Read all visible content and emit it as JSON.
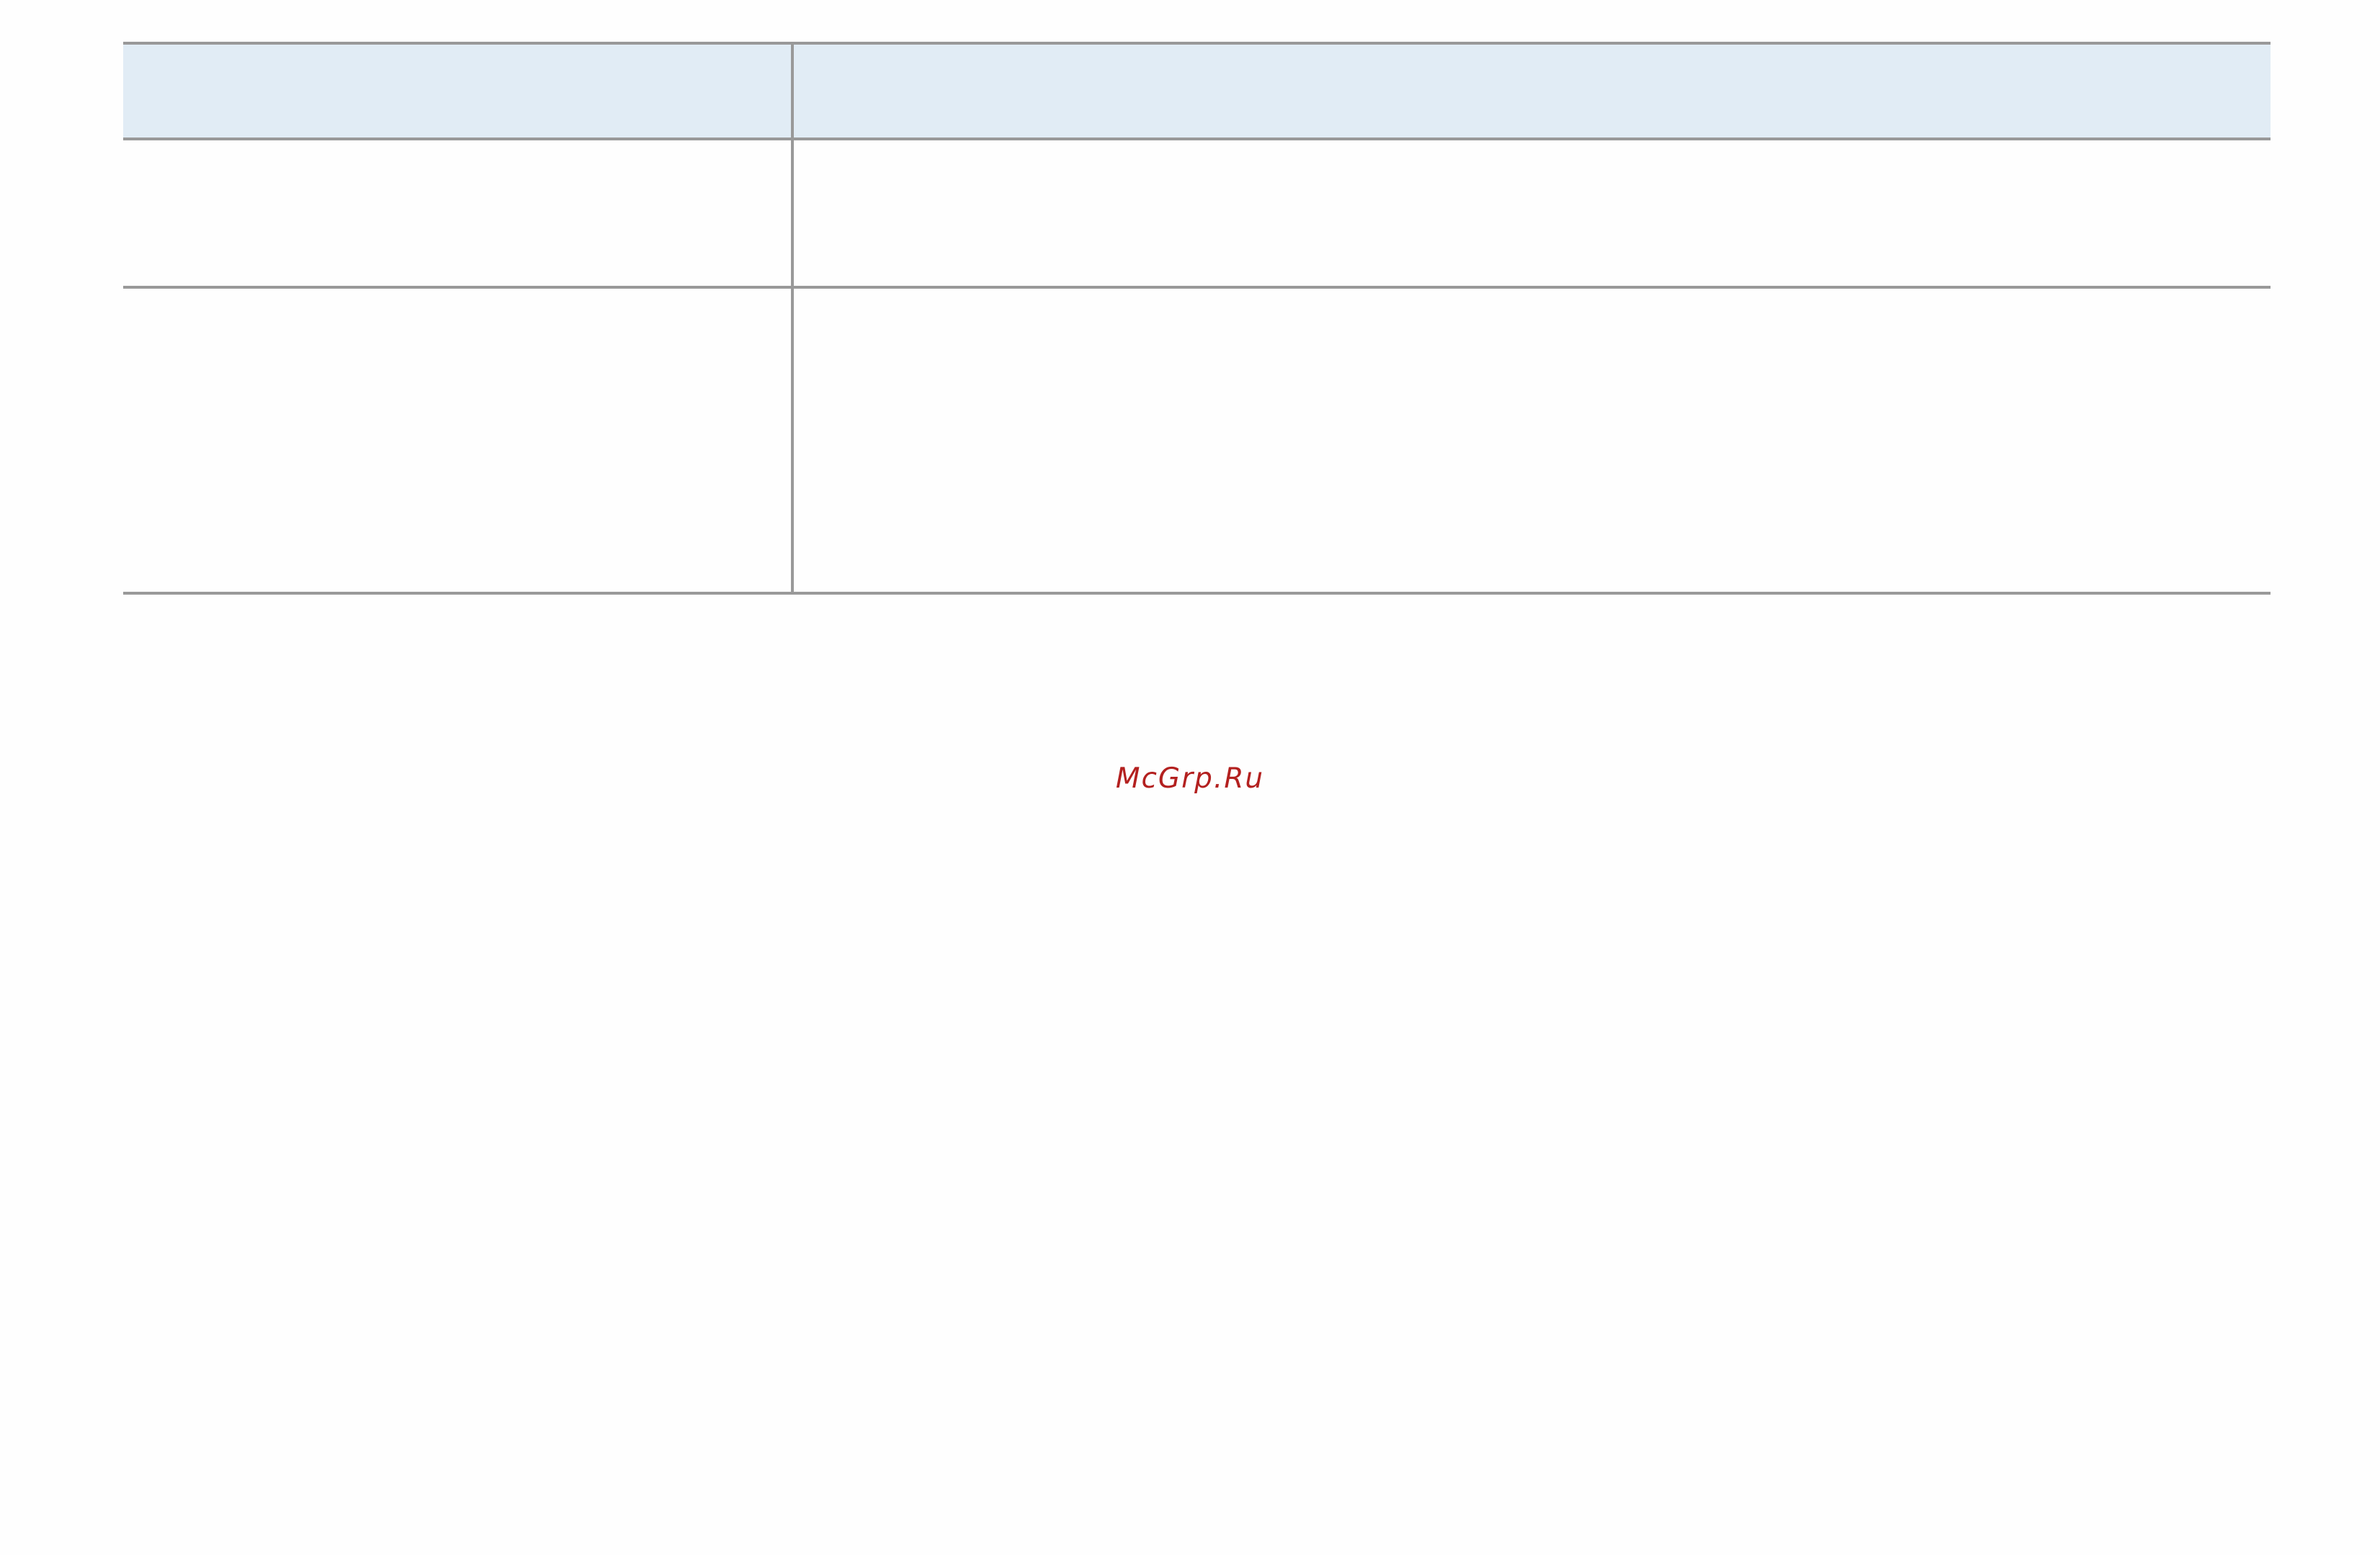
{
  "table": {
    "header": [
      "",
      ""
    ],
    "rows": [
      [
        "",
        ""
      ],
      [
        "",
        ""
      ]
    ]
  },
  "watermark": "McGrp.Ru",
  "colors": {
    "header_fill": "#e1ecf5",
    "rule": "#999999",
    "watermark": "#b3201f",
    "page": "#fefefe"
  }
}
